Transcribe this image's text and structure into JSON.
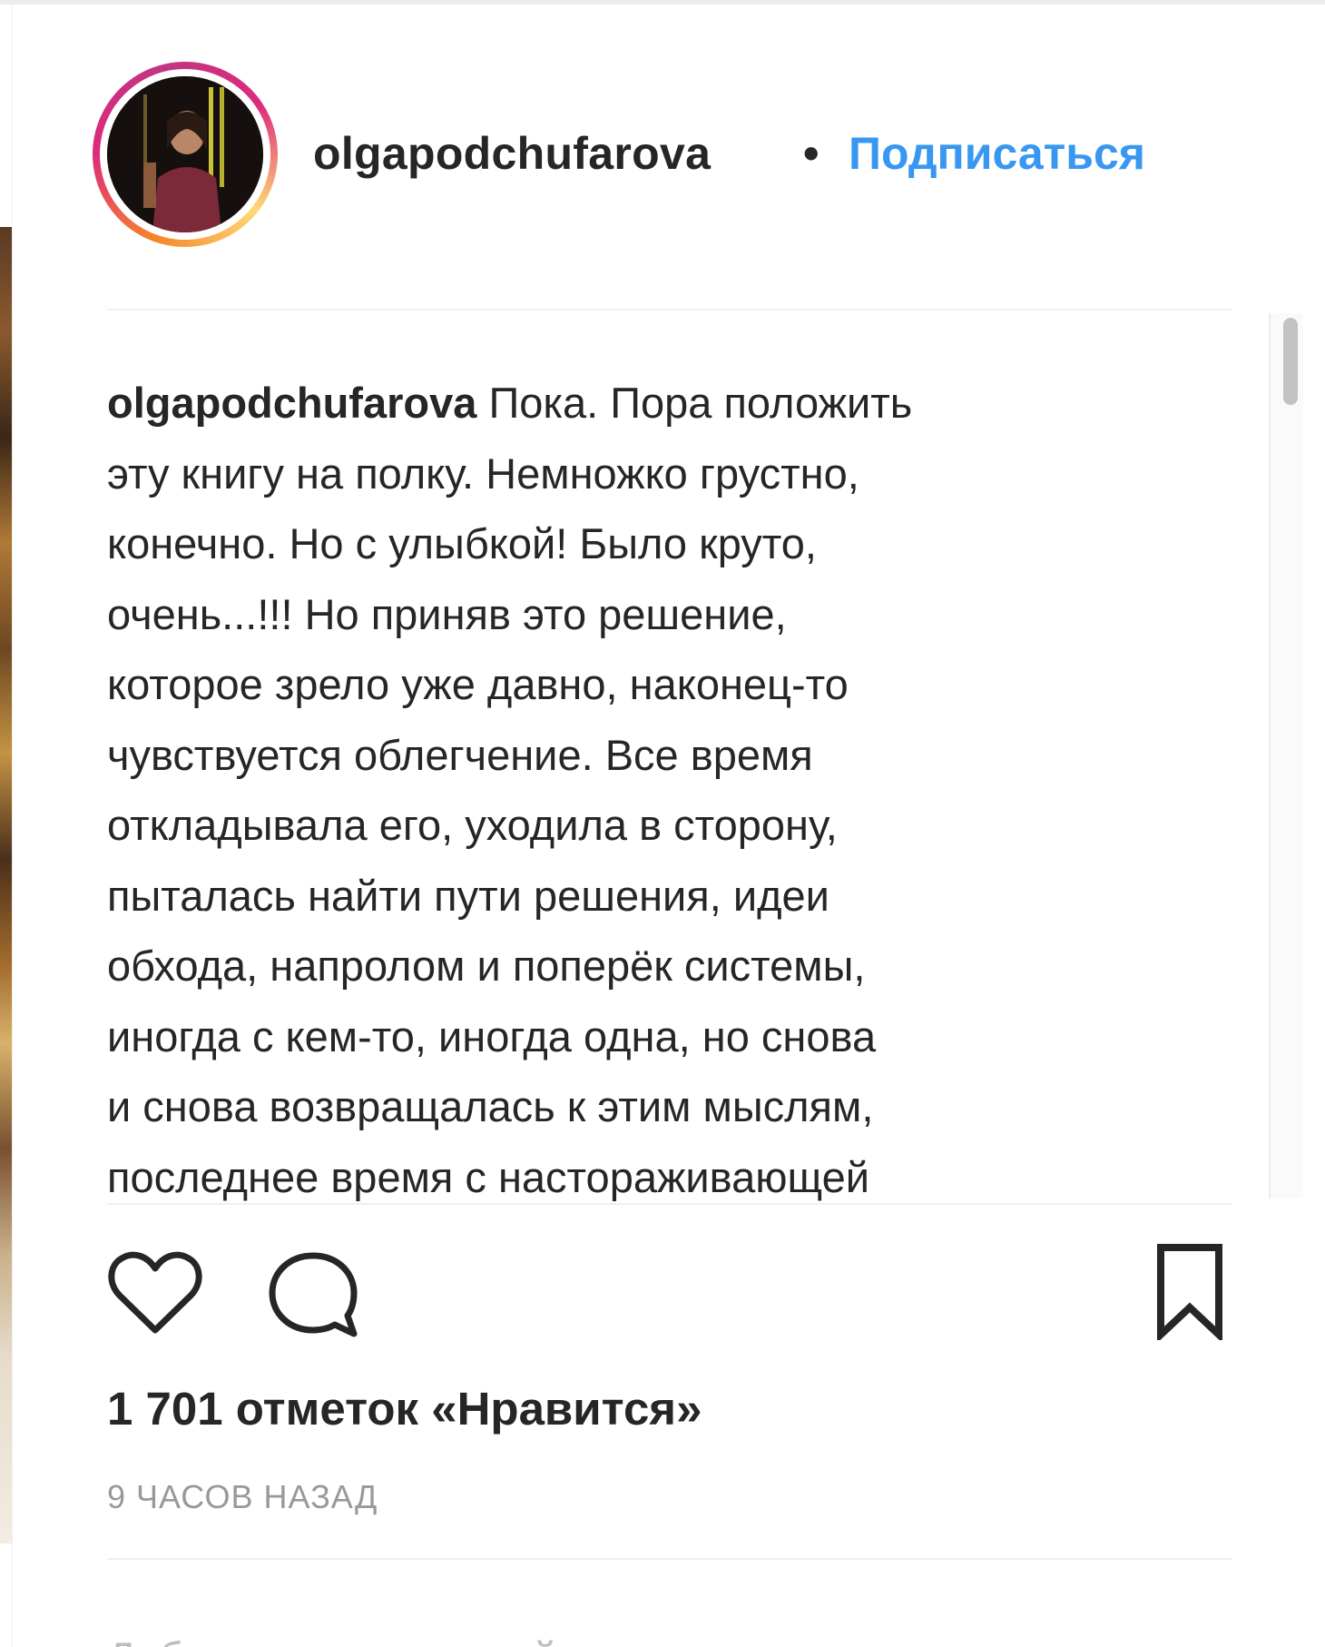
{
  "post": {
    "username": "olgapodchufarova",
    "separator": "•",
    "follow_label": "Подписаться",
    "caption": {
      "author": "olgapodchufarova",
      "text": "Пока. Пора положить\nэту книгу на полку. Немножко грустно,\nконечно. Но с улыбкой! Было круто,\nочень...!!! Но приняв это решение,\nкоторое зрело уже давно, наконец-то\nчувствуется облегчение. Все время\nоткладывала его, уходила в сторону,\nпыталась найти пути решения, идеи\nобхода, напролом и поперёк системы,\nиногда с кем-то, иногда одна, но снова\nи снова возвращалась к этим мыслям,\nпоследнее время с настораживающей"
    },
    "likes_text": "1 701 отметок «Нравится»",
    "timestamp": "9 часов назад",
    "comment_placeholder": "Добавьте комментарий..."
  },
  "colors": {
    "text": "#262626",
    "link_blue": "#3897f0",
    "muted": "#999999",
    "divider": "#efefef"
  },
  "icons": [
    "heart-icon",
    "comment-icon",
    "bookmark-icon"
  ]
}
